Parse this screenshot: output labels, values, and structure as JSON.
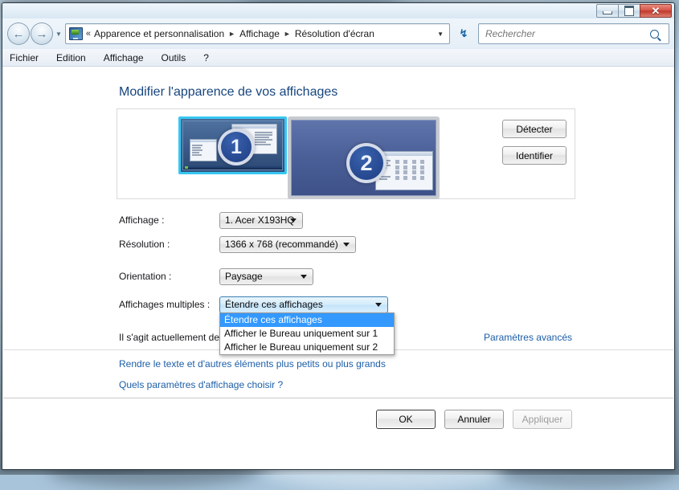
{
  "window": {
    "controls": {
      "minimize": "minimize-button",
      "maximize": "maximize-button",
      "close": "close-button"
    }
  },
  "addressbar": {
    "breadcrumb_prefix": "«",
    "crumbs": [
      "Apparence et personnalisation",
      "Affichage",
      "Résolution d'écran"
    ],
    "separator": "►",
    "dropdown_caret": "▼",
    "refresh_glyph": "↯"
  },
  "search": {
    "placeholder": "Rechercher",
    "value": ""
  },
  "menubar": {
    "items": [
      "Fichier",
      "Edition",
      "Affichage",
      "Outils",
      "?"
    ]
  },
  "page": {
    "title": "Modifier l'apparence de vos affichages"
  },
  "preview": {
    "monitor1": {
      "number": "1"
    },
    "monitor2": {
      "number": "2"
    },
    "detect_button": "Détecter",
    "identify_button": "Identifier"
  },
  "form": {
    "rows": [
      {
        "label": "Affichage :",
        "value": "1. Acer X193HQ"
      },
      {
        "label": "Résolution :",
        "value": "1366 x 768 (recommandé)"
      },
      {
        "label": "Orientation :",
        "value": "Paysage"
      },
      {
        "label": "Affichages multiples :",
        "value": "Étendre ces affichages"
      }
    ]
  },
  "dropdown": {
    "open": true,
    "options": [
      "Étendre ces affichages",
      "Afficher le Bureau uniquement sur 1",
      "Afficher le Bureau uniquement sur 2"
    ],
    "selected_index": 0
  },
  "info": {
    "current_text": "Il s'agit actuellement de",
    "advanced_link": "Paramètres avancés",
    "link_text_size": "Rendre le texte et d'autres éléments plus petits ou plus grands",
    "link_which_settings": "Quels paramètres d'affichage choisir ?"
  },
  "dialog_buttons": {
    "ok": "OK",
    "cancel": "Annuler",
    "apply": "Appliquer"
  },
  "colors": {
    "accent_blue": "#17457e",
    "link_blue": "#1c5ea8",
    "selection_blue": "#3399ff",
    "focus_border": "#3c7fb1",
    "monitor_highlight": "#37c6f2"
  }
}
